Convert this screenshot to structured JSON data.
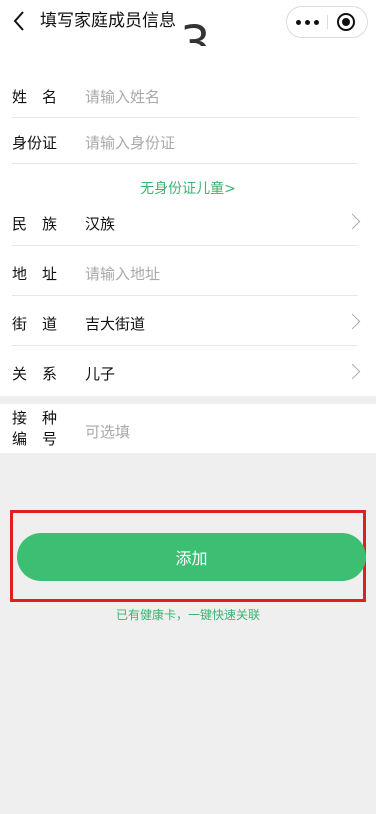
{
  "header": {
    "title": "填写家庭成员信息",
    "step": "3",
    "back_icon": "chevron-left-icon",
    "more_icon": "more-dots-icon",
    "close_icon": "target-close-icon"
  },
  "form": {
    "name": {
      "label": "姓　名",
      "placeholder": "请输入姓名"
    },
    "id_card": {
      "label": "身份证",
      "placeholder": "请输入身份证"
    },
    "no_id_link": "无身份证儿童>",
    "ethnicity": {
      "label": "民　族",
      "value": "汉族"
    },
    "address": {
      "label": "地　址",
      "placeholder": "请输入地址"
    },
    "street": {
      "label": "街　道",
      "value": "吉大街道"
    },
    "relation": {
      "label": "关　系",
      "value": "儿子"
    },
    "vaccine": {
      "label_line1": "接　种",
      "label_line2": "编　号",
      "placeholder": "可选填"
    }
  },
  "actions": {
    "add_label": "添加",
    "link_card_label": "已有健康卡，一键快速关联"
  },
  "colors": {
    "accent": "#3dbf73",
    "highlight": "#e02020",
    "placeholder": "#a9a9a9"
  }
}
